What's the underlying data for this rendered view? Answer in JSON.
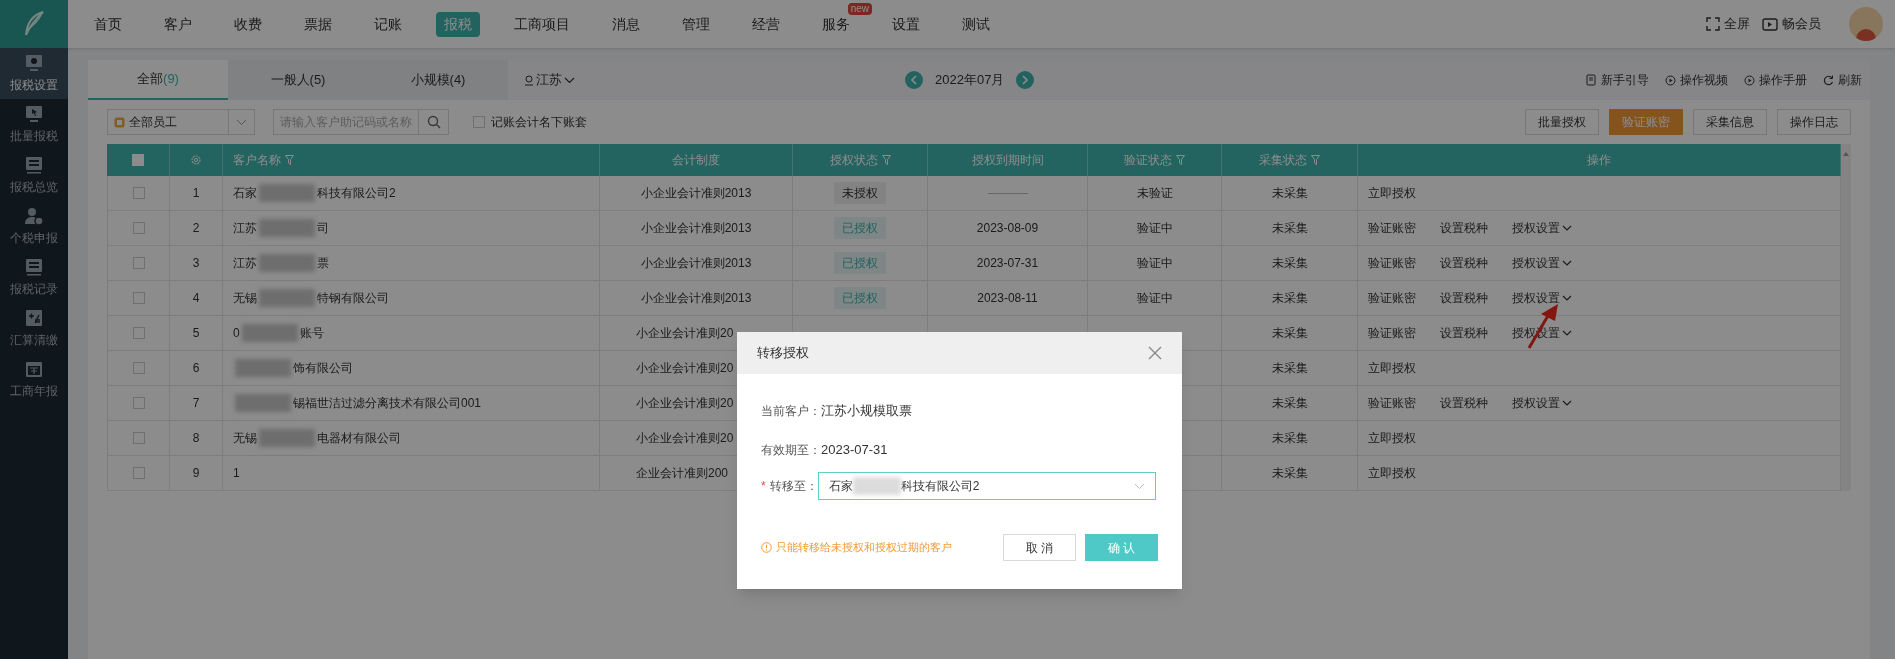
{
  "nav": {
    "items": [
      {
        "label": "首页",
        "selected": false
      },
      {
        "label": "客户",
        "selected": false
      },
      {
        "label": "收费",
        "selected": false
      },
      {
        "label": "票据",
        "selected": false
      },
      {
        "label": "记账",
        "selected": false
      },
      {
        "label": "报税",
        "selected": true
      },
      {
        "label": "工商项目",
        "selected": false
      },
      {
        "label": "消息",
        "selected": false
      },
      {
        "label": "管理",
        "selected": false
      },
      {
        "label": "经营",
        "selected": false
      },
      {
        "label": "服务",
        "selected": false,
        "badge": "new"
      },
      {
        "label": "设置",
        "selected": false
      },
      {
        "label": "测试",
        "selected": false
      }
    ],
    "right": [
      {
        "kind": "fullscreen",
        "label": "全屏"
      },
      {
        "kind": "video",
        "label": "畅会员"
      }
    ]
  },
  "sidebar": {
    "items": [
      {
        "kind": "gear",
        "label": "报税设置",
        "selected": true
      },
      {
        "kind": "pointer",
        "label": "批量报税",
        "selected": false
      },
      {
        "kind": "tax",
        "label": "报税总览",
        "selected": false
      },
      {
        "kind": "person",
        "label": "个税申报",
        "selected": false
      },
      {
        "kind": "tax",
        "label": "报税记录",
        "selected": false
      },
      {
        "kind": "calc",
        "label": "汇算清缴",
        "selected": false
      },
      {
        "kind": "calendar",
        "label": "工商年报",
        "selected": false
      }
    ]
  },
  "tabs": [
    {
      "label": "全部",
      "count": "(9)",
      "selected": true
    },
    {
      "label": "一般人(5)",
      "selected": false
    },
    {
      "label": "小规模(4)",
      "selected": false
    }
  ],
  "region": "江苏",
  "month": "2022年07月",
  "help_links": [
    {
      "kind": "guide",
      "label": "新手引导"
    },
    {
      "kind": "play",
      "label": "操作视频"
    },
    {
      "kind": "play",
      "label": "操作手册"
    },
    {
      "kind": "refresh",
      "label": "刷新"
    }
  ],
  "toolbar": {
    "staff": "全部员工",
    "search_placeholder": "请输入客户助记码或名称",
    "own_accounts": {
      "label": "记账会计名下账套",
      "checked": false
    },
    "buttons": [
      {
        "label": "批量授权",
        "primary": false
      },
      {
        "label": "验证账密",
        "primary": true
      },
      {
        "label": "采集信息",
        "primary": false
      },
      {
        "label": "操作日志",
        "primary": false
      }
    ]
  },
  "table": {
    "header_checked": false,
    "columns": [
      {
        "label": "客户名称",
        "filter": true
      },
      {
        "label": "会计制度",
        "filter": false
      },
      {
        "label": "授权状态",
        "filter": true
      },
      {
        "label": "授权到期时间",
        "filter": false
      },
      {
        "label": "验证状态",
        "filter": true
      },
      {
        "label": "采集状态",
        "filter": true
      },
      {
        "label": "操作",
        "filter": false
      }
    ],
    "rows": [
      {
        "checked": false,
        "no": "1",
        "name": [
          {
            "kind": "text",
            "text": "石家"
          },
          {
            "kind": "blur"
          },
          {
            "kind": "text",
            "text": "科技有限公司2"
          }
        ],
        "system": "小企业会计准则2013",
        "auth": {
          "label": "未授权",
          "authorized": false
        },
        "expiry": null,
        "verify": "未验证",
        "collect": "未采集",
        "ops": [
          {
            "label": "立即授权",
            "kind": "link"
          }
        ]
      },
      {
        "checked": false,
        "no": "2",
        "name": [
          {
            "kind": "text",
            "text": "江苏"
          },
          {
            "kind": "blur"
          },
          {
            "kind": "text",
            "text": "司"
          }
        ],
        "system": "小企业会计准则2013",
        "auth": {
          "label": "已授权",
          "authorized": true
        },
        "expiry": "2023-08-09",
        "verify": "验证中",
        "collect": "未采集",
        "ops": [
          {
            "label": "验证账密",
            "kind": "link"
          },
          {
            "label": "设置税种",
            "kind": "link"
          },
          {
            "label": "授权设置",
            "kind": "dropdown"
          }
        ]
      },
      {
        "checked": false,
        "no": "3",
        "name": [
          {
            "kind": "text",
            "text": "江苏"
          },
          {
            "kind": "blur"
          },
          {
            "kind": "text",
            "text": "票"
          }
        ],
        "system": "小企业会计准则2013",
        "auth": {
          "label": "已授权",
          "authorized": true
        },
        "expiry": "2023-07-31",
        "verify": "验证中",
        "collect": "未采集",
        "ops": [
          {
            "label": "验证账密",
            "kind": "link"
          },
          {
            "label": "设置税种",
            "kind": "link"
          },
          {
            "label": "授权设置",
            "kind": "dropdown"
          }
        ]
      },
      {
        "checked": false,
        "no": "4",
        "name": [
          {
            "kind": "text",
            "text": "无锡"
          },
          {
            "kind": "blur"
          },
          {
            "kind": "text",
            "text": "特钢有限公司"
          }
        ],
        "system": "小企业会计准则2013",
        "auth": {
          "label": "已授权",
          "authorized": true
        },
        "expiry": "2023-08-11",
        "verify": "验证中",
        "collect": "未采集",
        "ops": [
          {
            "label": "验证账密",
            "kind": "link"
          },
          {
            "label": "设置税种",
            "kind": "link"
          },
          {
            "label": "授权设置",
            "kind": "dropdown"
          }
        ]
      },
      {
        "checked": false,
        "no": "5",
        "name": [
          {
            "kind": "text",
            "text": "0"
          },
          {
            "kind": "blur"
          },
          {
            "kind": "text",
            "text": "账号"
          }
        ],
        "system": "小企业会计准则20",
        "collect": "未采集",
        "ops": [
          {
            "label": "验证账密",
            "kind": "link"
          },
          {
            "label": "设置税种",
            "kind": "link"
          },
          {
            "label": "授权设置",
            "kind": "dropdown"
          }
        ]
      },
      {
        "checked": false,
        "no": "6",
        "name": [
          {
            "kind": "blur"
          },
          {
            "kind": "text",
            "text": "饰有限公司"
          }
        ],
        "system": "小企业会计准则20",
        "collect": "未采集",
        "ops": [
          {
            "label": "立即授权",
            "kind": "link"
          }
        ]
      },
      {
        "checked": false,
        "no": "7",
        "name": [
          {
            "kind": "blur"
          },
          {
            "kind": "text",
            "text": "锡福世洁过滤分离技术有限公司001"
          }
        ],
        "system": "小企业会计准则20",
        "collect": "未采集",
        "ops": [
          {
            "label": "验证账密",
            "kind": "link"
          },
          {
            "label": "设置税种",
            "kind": "link"
          },
          {
            "label": "授权设置",
            "kind": "dropdown"
          }
        ]
      },
      {
        "checked": false,
        "no": "8",
        "name": [
          {
            "kind": "text",
            "text": "无锡"
          },
          {
            "kind": "blur"
          },
          {
            "kind": "text",
            "text": "电器材有限公司"
          }
        ],
        "system": "小企业会计准则20",
        "collect": "未采集",
        "ops": [
          {
            "label": "立即授权",
            "kind": "link"
          }
        ]
      },
      {
        "checked": false,
        "no": "9",
        "name": [
          {
            "kind": "text",
            "text": "1"
          }
        ],
        "system": "企业会计准则200",
        "collect": "未采集",
        "ops": [
          {
            "label": "立即授权",
            "kind": "link"
          }
        ]
      }
    ]
  },
  "modal": {
    "title": "转移授权",
    "fields": [
      {
        "label": "当前客户：",
        "value": "江苏小规模取票"
      },
      {
        "label": "有效期至：",
        "value": "2023-07-31"
      }
    ],
    "transfer": {
      "required_mark": "*",
      "label": "转移至：",
      "value": [
        "石家",
        "科技有限公司2"
      ]
    },
    "note": "只能转移给未授权和授权过期的客户",
    "cancel": "取 消",
    "confirm": "确 认"
  }
}
